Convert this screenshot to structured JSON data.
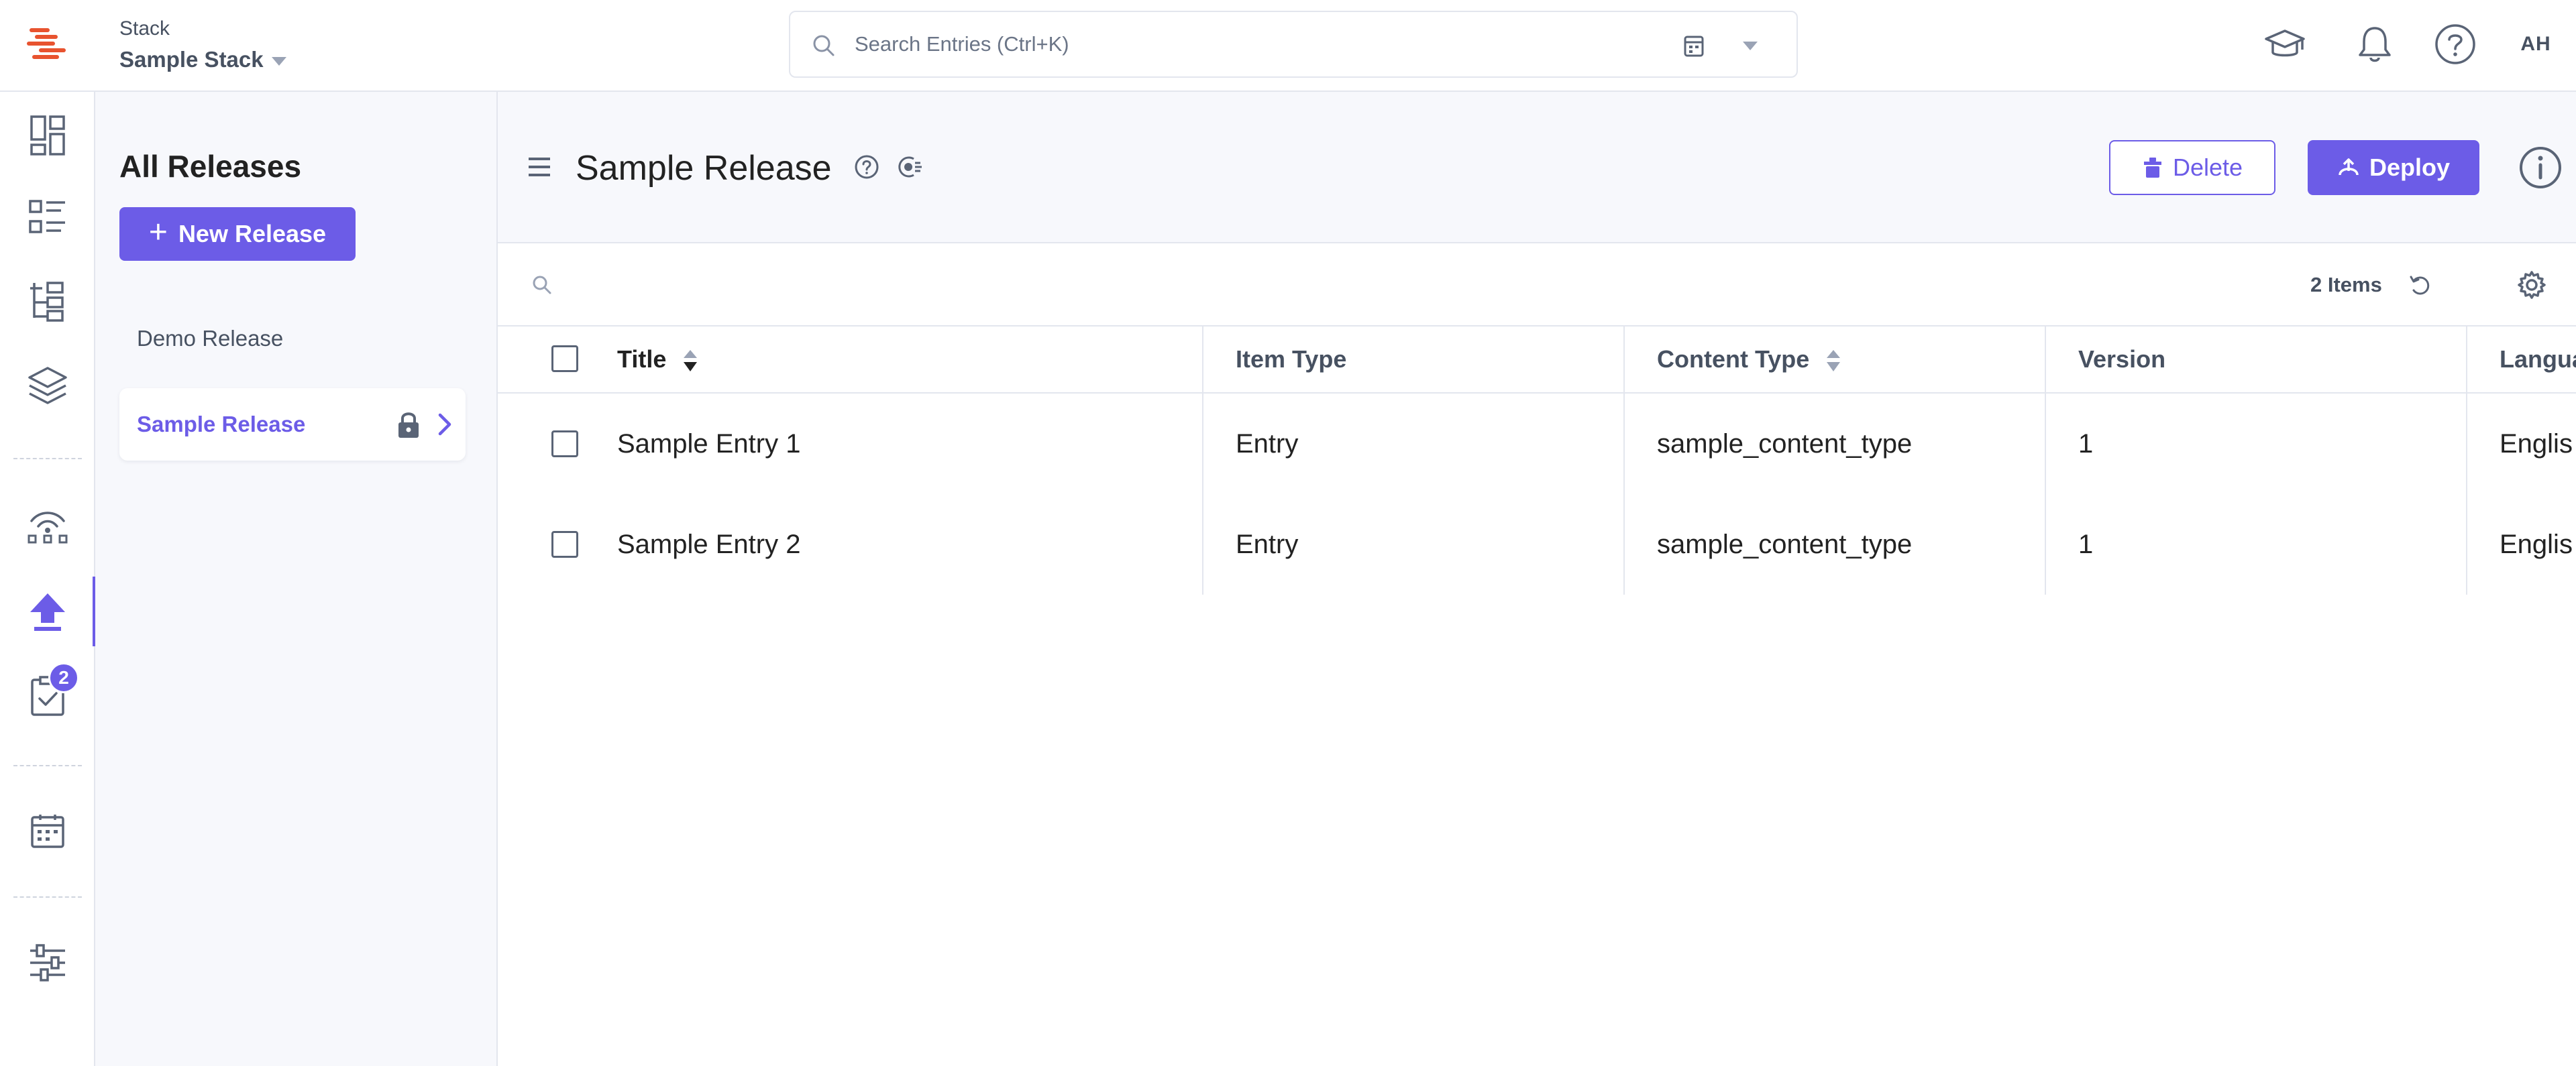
{
  "header": {
    "stack_label": "Stack",
    "stack_name": "Sample Stack",
    "search_placeholder": "Search Entries (Ctrl+K)",
    "avatar_initials": "AH",
    "icons": [
      "academy-cap-icon",
      "bell-icon",
      "help-icon"
    ]
  },
  "rail": {
    "icons": [
      "dashboard-icon",
      "entries-list-icon",
      "content-models-icon",
      "assets-layers-icon",
      "workflow-icon",
      "publish-queue-icon",
      "tasks-icon",
      "calendar-icon",
      "settings-sliders-icon"
    ],
    "tasks_badge": "2",
    "active": "publish-queue-icon"
  },
  "releases_panel": {
    "title": "All Releases",
    "new_button": "New Release",
    "items": [
      {
        "label": "Demo Release",
        "active": false
      },
      {
        "label": "Sample Release",
        "active": true,
        "locked": true
      }
    ]
  },
  "main": {
    "title": "Sample Release",
    "delete_button": "Delete",
    "deploy_button": "Deploy",
    "items_count": "2 Items",
    "columns": [
      "Title",
      "Item Type",
      "Content Type",
      "Version",
      "Langua"
    ],
    "rows": [
      {
        "title": "Sample Entry 1",
        "item_type": "Entry",
        "content_type": "sample_content_type",
        "version": "1",
        "language": "Englis"
      },
      {
        "title": "Sample Entry 2",
        "item_type": "Entry",
        "content_type": "sample_content_type",
        "version": "1",
        "language": "Englis"
      }
    ]
  },
  "colors": {
    "accent": "#6c5ce7",
    "logo": "#e8532f",
    "text": "#222222",
    "muted": "#475161",
    "border": "#e3e6ee",
    "panel_bg": "#f7f8fc"
  }
}
